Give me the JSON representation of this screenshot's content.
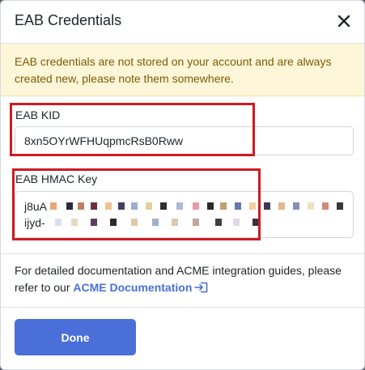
{
  "modal": {
    "title": "EAB Credentials",
    "close_label": "×"
  },
  "warning": {
    "text": "EAB credentials are not stored on your account and are always created new, please note them somewhere."
  },
  "kid": {
    "label": "EAB KID",
    "value": "8xn5OYrWFHUqpmcRsB0Rww"
  },
  "hmac": {
    "label": "EAB HMAC Key",
    "line1_prefix": "j8uA",
    "line2_prefix": "ijyd-"
  },
  "docs": {
    "text_before": "For detailed documentation and ACME integration guides, please refer to our ",
    "link_label": "ACME Documentation"
  },
  "footer": {
    "done_label": "Done"
  },
  "colors": {
    "accent": "#4a6fd8",
    "highlight": "#d01a22",
    "warning_bg": "#fdf6d8",
    "warning_text": "#7a5d06"
  }
}
